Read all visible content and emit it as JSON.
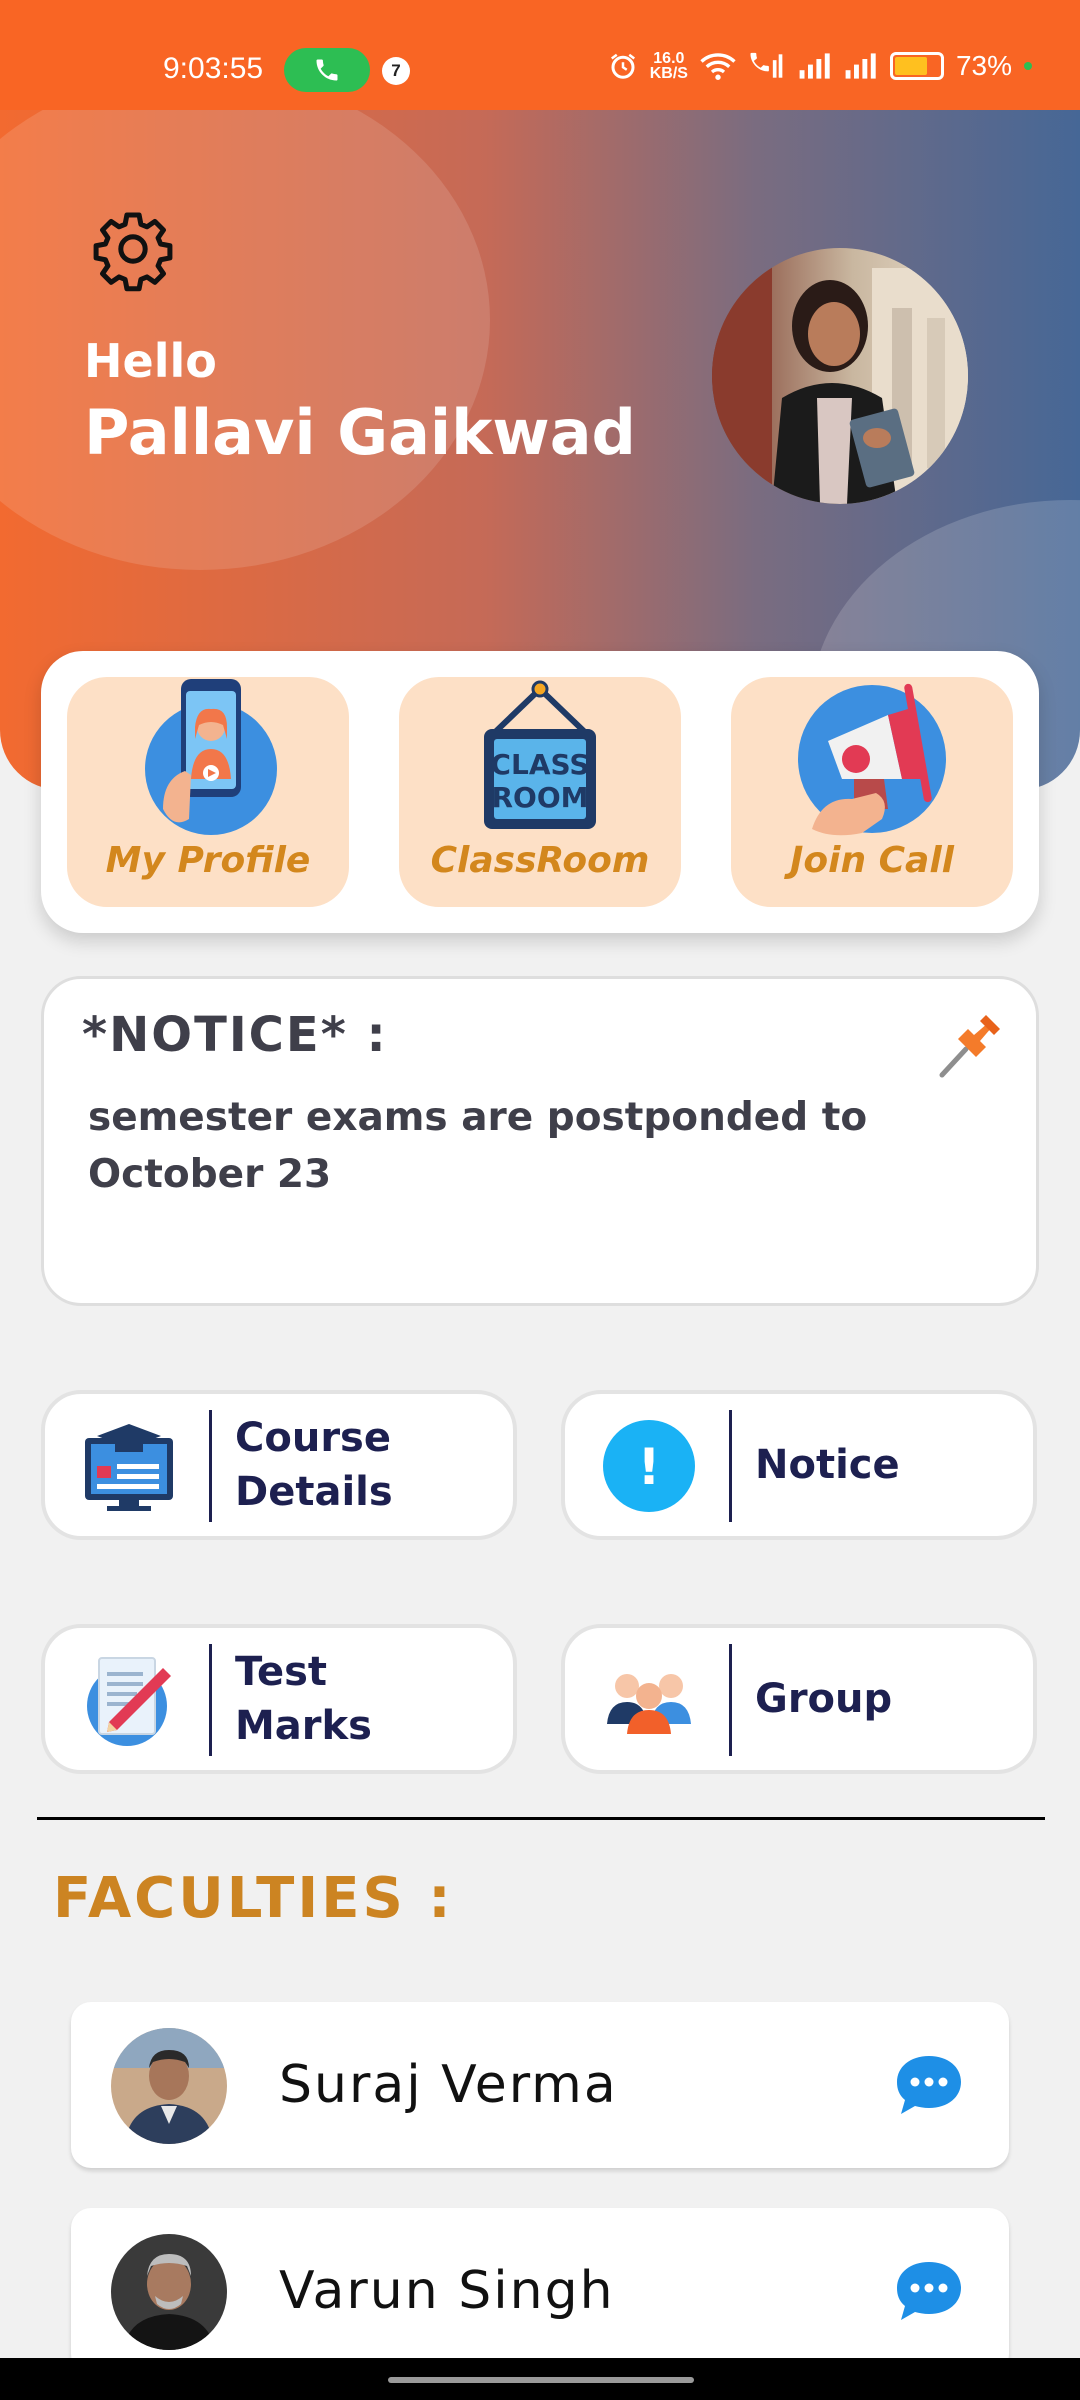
{
  "status_bar": {
    "time": "9:03:55",
    "call_badge": "7",
    "speed_value": "16.0",
    "speed_unit": "KB/S",
    "battery": "73%",
    "battery_level": 0.73
  },
  "header": {
    "greeting": "Hello",
    "user_name": "Pallavi Gaikwad"
  },
  "quick_actions": [
    {
      "label": "My Profile",
      "icon": "profile-phone-icon"
    },
    {
      "label": "ClassRoom",
      "icon": "classroom-sign-icon"
    },
    {
      "label": "Join Call",
      "icon": "megaphone-icon"
    }
  ],
  "classroom_sign": {
    "line1": "CLASS",
    "line2": "ROOM"
  },
  "notice": {
    "title": "*NOTICE* :",
    "body": "semester exams are postponded to October 23"
  },
  "menu": [
    {
      "label": "Course\nDetails",
      "icon": "course-details-icon"
    },
    {
      "label": "Notice",
      "icon": "notice-alert-icon"
    },
    {
      "label": "Test\nMarks",
      "icon": "test-marks-icon"
    },
    {
      "label": "Group",
      "icon": "group-icon"
    }
  ],
  "notice_icon_glyph": "!",
  "faculties": {
    "title": "FACULTIES :",
    "items": [
      {
        "name": "Suraj Verma"
      },
      {
        "name": "Varun Singh"
      }
    ]
  },
  "colors": {
    "accent_orange": "#f96524",
    "tile_bg": "#fde0c6",
    "tile_text": "#d3871d",
    "menu_text": "#1d2050",
    "faculty_title": "#cc8422"
  }
}
